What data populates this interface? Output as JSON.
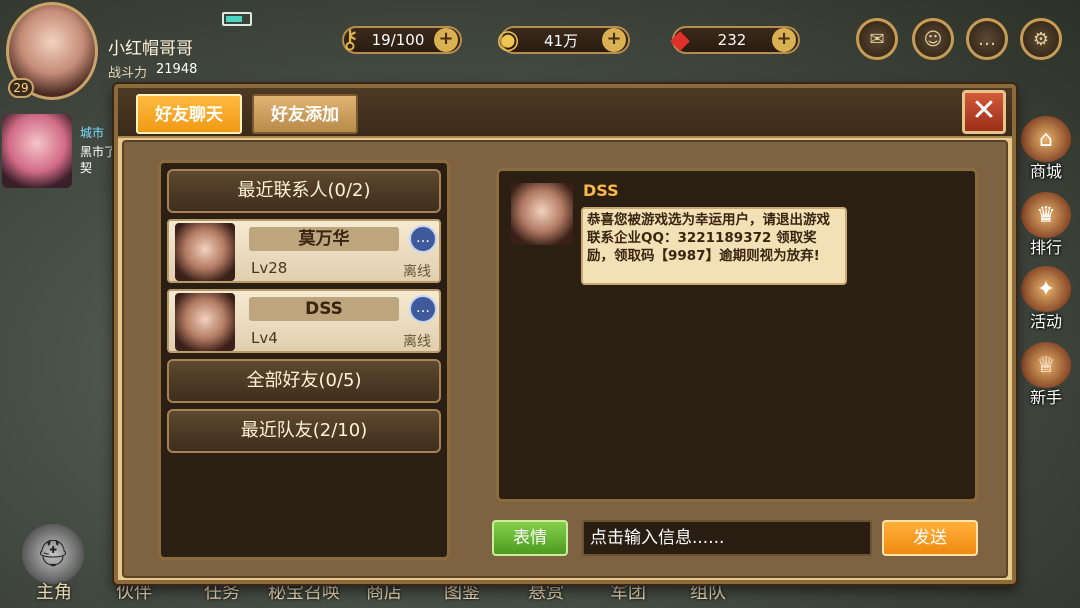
{
  "hud": {
    "player_name": "小红帽哥哥",
    "power_label": "战斗力",
    "power_value": "21948",
    "level": "29",
    "city": {
      "tag": "城市",
      "text": "黑市了契"
    }
  },
  "resources": [
    {
      "icon": "key-icon",
      "value": "19/100"
    },
    {
      "icon": "coin-icon",
      "value": "41万"
    },
    {
      "icon": "gem-icon",
      "value": "232"
    }
  ],
  "side_menu": [
    {
      "label": "商城"
    },
    {
      "label": "排行"
    },
    {
      "label": "活动"
    },
    {
      "label": "新手"
    }
  ],
  "bottom_menu": {
    "hero": "主角",
    "items": [
      "伙伴",
      "任务",
      "秘宝召唤",
      "商店",
      "图鉴",
      "悬赏",
      "军团",
      "组队"
    ]
  },
  "dialog": {
    "tabs": {
      "chat": "好友聊天",
      "add": "好友添加"
    },
    "groups": {
      "recent_contacts": "最近联系人(0/2)",
      "all_friends": "全部好友(0/5)",
      "recent_teammates": "最近队友(2/10)"
    },
    "contacts": [
      {
        "name": "莫万华",
        "level": "Lv28",
        "status": "离线"
      },
      {
        "name": "DSS",
        "level": "Lv4",
        "status": "离线"
      }
    ],
    "message": {
      "sender": "DSS",
      "text": "恭喜您被游戏选为幸运用户，请退出游戏联系企业QQ：3221189372 领取奖励，领取码【9987】逾期则视为放弃!"
    },
    "input": {
      "emote_label": "表情",
      "placeholder": "点击输入信息......",
      "send_label": "发送"
    }
  }
}
